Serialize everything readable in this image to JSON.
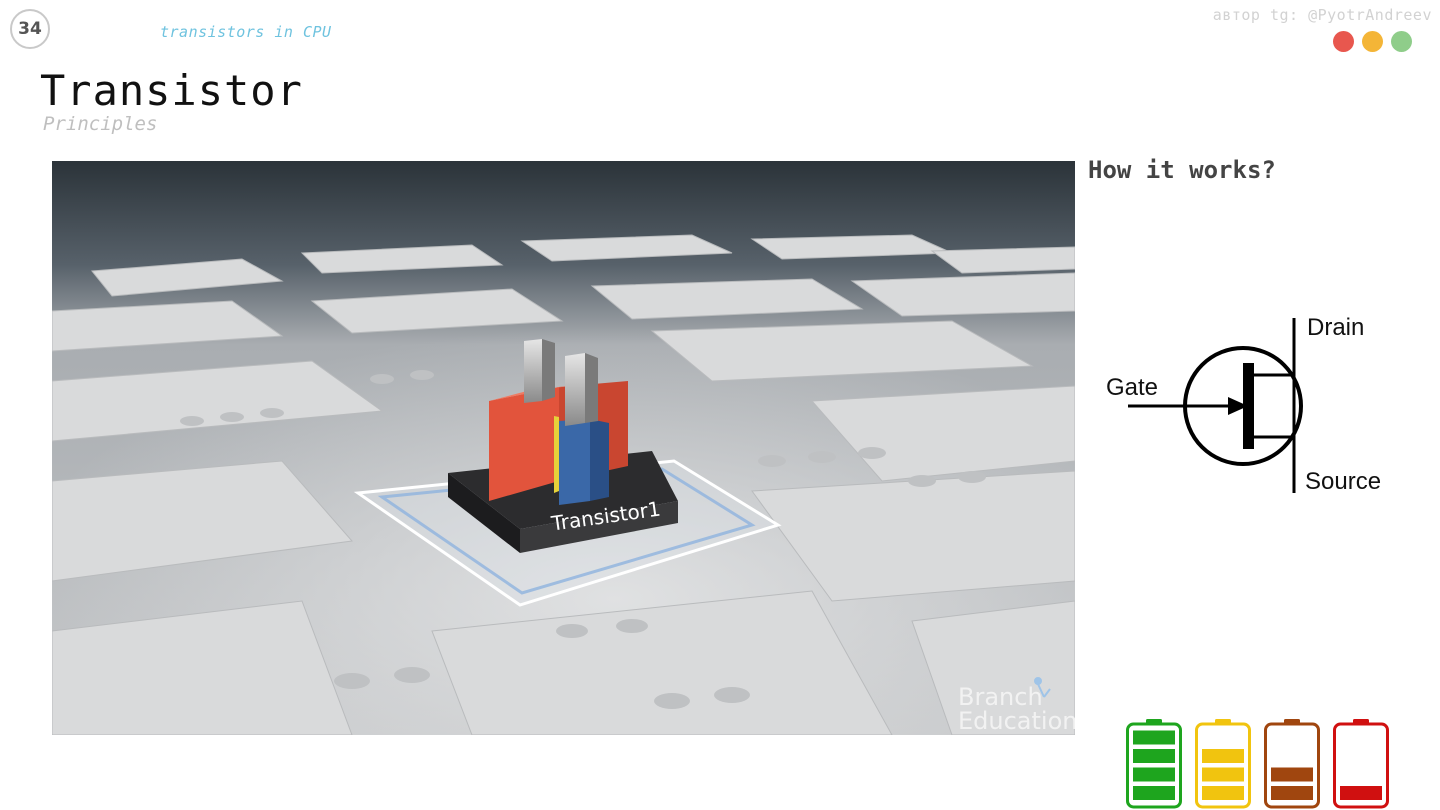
{
  "slide": {
    "number": "34",
    "topic": "transistors in CPU",
    "author": "автор tg: @PyotrAndreev",
    "title": "Transistor",
    "subtitle": "Principles"
  },
  "window_dots": [
    "#e8574e",
    "#f4b537",
    "#8fcd8a"
  ],
  "image": {
    "label": "Transistor1",
    "watermark_line1": "Branch",
    "watermark_line2": "Education"
  },
  "panel": {
    "heading": "How it works?"
  },
  "symbol": {
    "drain": "Drain",
    "gate": "Gate",
    "source": "Source"
  },
  "batteries": [
    {
      "color": "#1ea51e",
      "filled_bars": 4
    },
    {
      "color": "#f1c40f",
      "filled_bars": 3
    },
    {
      "color": "#a0460f",
      "filled_bars": 2
    },
    {
      "color": "#d01010",
      "filled_bars": 1
    }
  ]
}
